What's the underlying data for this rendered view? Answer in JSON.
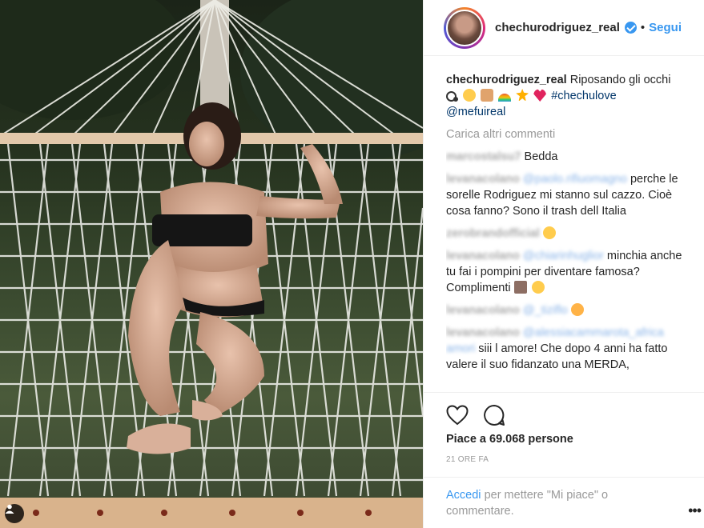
{
  "post": {
    "username": "chechurodriguez_real",
    "follow_label": "Segui",
    "dot": "•",
    "caption": {
      "username": "chechurodriguez_real",
      "text": "Riposando gli occhi",
      "hashtag": "#chechulove",
      "mention": "@mefuireal"
    },
    "load_more": "Carica altri commenti",
    "comments": [
      {
        "user": "marcostalsu7",
        "text": "Bedda"
      },
      {
        "user": "levanacolano",
        "tag": "@paolo.rifiuomagno",
        "text": "perche le sorelle Rodriguez mi stanno sul cazzo. Cioè cosa fanno? Sono il trash dell Italia"
      },
      {
        "user": "zerobrandofficial",
        "text": ""
      },
      {
        "user": "levanacolano",
        "tag": "@chiarinhuglior",
        "text": "minchia anche tu fai i pompini per diventare famosa? Complimenti"
      },
      {
        "user": "levanacolano",
        "tag": "@_tiziflo",
        "text": ""
      },
      {
        "user": "levanacolano",
        "tag": "@alessiacammarota_africa",
        "tag2": "amori",
        "text": "siii l amore! Che dopo 4 anni ha fatto valere il suo fidanzato una MERDA,"
      }
    ],
    "likes": "Piace a 69.068 persone",
    "time": "21 ORE FA",
    "login_link": "Accedi",
    "login_text": "per mettere \"Mi piace\" o commentare.",
    "more": "•••"
  },
  "icons": [
    "user-tag-icon",
    "verified-badge-icon",
    "heart-icon",
    "comment-icon",
    "more-options-icon"
  ],
  "colors": {
    "link": "#3897f0",
    "hashtag": "#003569",
    "muted": "#999999"
  }
}
